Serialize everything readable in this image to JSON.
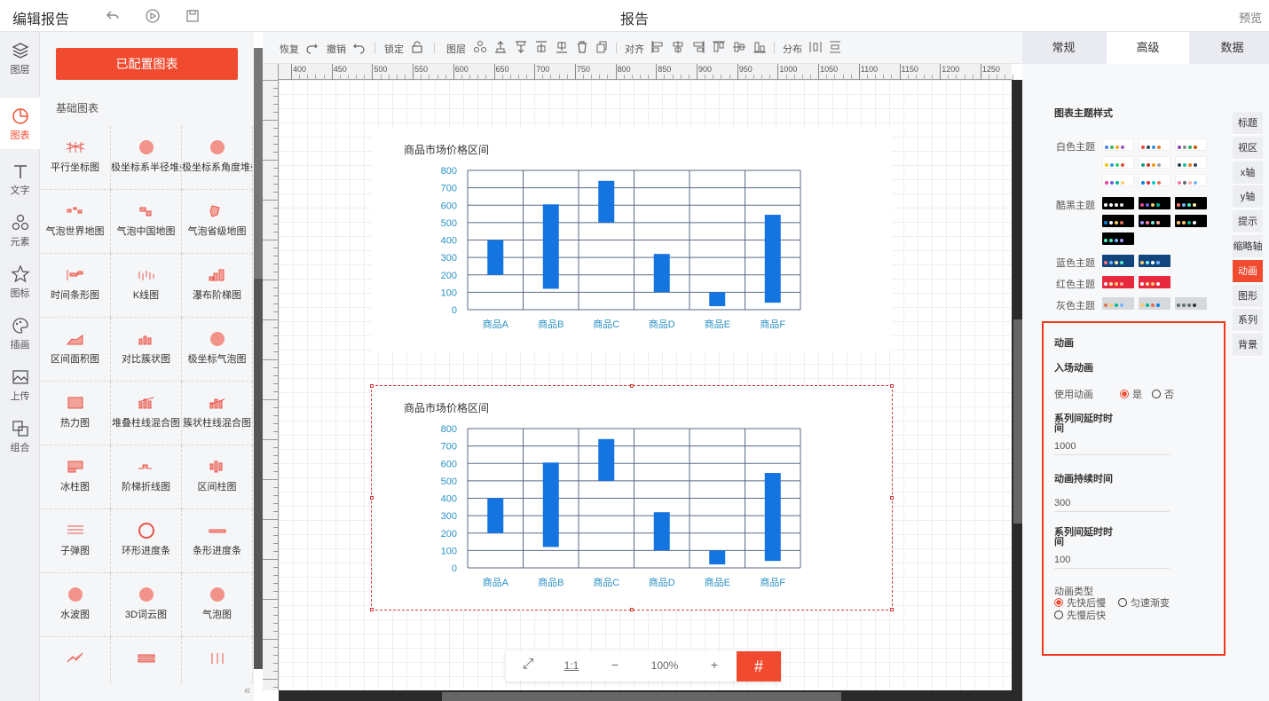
{
  "topbar": {
    "title": "编辑报告",
    "page_name": "报告",
    "preview": "预览"
  },
  "leftnav": [
    {
      "label": "图层",
      "icon": "layers-icon"
    },
    {
      "label": "图表",
      "icon": "chart-pie-icon"
    },
    {
      "label": "文字",
      "icon": "text-icon"
    },
    {
      "label": "元素",
      "icon": "shapes-icon"
    },
    {
      "label": "图标",
      "icon": "star-icon"
    },
    {
      "label": "插画",
      "icon": "palette-icon"
    },
    {
      "label": "上传",
      "icon": "image-upload-icon"
    },
    {
      "label": "组合",
      "icon": "group-icon"
    }
  ],
  "panel": {
    "configured_button": "已配置图表",
    "section_label": "基础图表",
    "charts": [
      "平行坐标图",
      "极坐标系半径堆叠",
      "极坐标系角度堆叠",
      "气泡世界地图",
      "气泡中国地图",
      "气泡省级地图",
      "时间条形图",
      "K线图",
      "瀑布阶梯图",
      "区间面积图",
      "对比簇状图",
      "极坐标气泡图",
      "热力图",
      "堆叠柱线混合图",
      "簇状柱线混合图",
      "冰柱图",
      "阶梯折线图",
      "区间柱图",
      "子弹图",
      "环形进度条",
      "条形进度条",
      "水波图",
      "3D词云图",
      "气泡图",
      "",
      "",
      ""
    ]
  },
  "toolbar": {
    "redo": "恢复",
    "undo": "撤销",
    "lock": "锁定",
    "layer": "图层",
    "align": "对齐",
    "distribute": "分布"
  },
  "ruler": {
    "ticks": [
      "400",
      "450",
      "500",
      "550",
      "600",
      "650",
      "700",
      "750",
      "800",
      "850",
      "900",
      "950",
      "1000",
      "1050",
      "1100",
      "1150",
      "1200",
      "1250"
    ]
  },
  "chart_data": [
    {
      "type": "bar",
      "title": "商品市场价格区间",
      "categories": [
        "商品A",
        "商品B",
        "商品C",
        "商品D",
        "商品E",
        "商品F"
      ],
      "ranges": [
        [
          200,
          400
        ],
        [
          120,
          605
        ],
        [
          500,
          740
        ],
        [
          100,
          320
        ],
        [
          20,
          100
        ],
        [
          40,
          545
        ]
      ],
      "ylim": [
        0,
        800
      ],
      "yticks": [
        "800",
        "700",
        "600",
        "500",
        "400",
        "300",
        "200",
        "100",
        "0"
      ],
      "bar_color": "#1474e0",
      "label_color": "#2b91c4"
    },
    {
      "type": "bar",
      "title": "商品市场价格区间",
      "categories": [
        "商品A",
        "商品B",
        "商品C",
        "商品D",
        "商品E",
        "商品F"
      ],
      "ranges": [
        [
          200,
          400
        ],
        [
          120,
          605
        ],
        [
          500,
          740
        ],
        [
          100,
          320
        ],
        [
          20,
          100
        ],
        [
          40,
          545
        ]
      ],
      "ylim": [
        0,
        800
      ],
      "yticks": [
        "800",
        "700",
        "600",
        "500",
        "400",
        "300",
        "200",
        "100",
        "0"
      ],
      "bar_color": "#1474e0",
      "label_color": "#2b91c4"
    }
  ],
  "zoom": {
    "fit": "⤢",
    "one_to_one": "1:1",
    "minus": "−",
    "value": "100%",
    "plus": "+",
    "grid": "#"
  },
  "right_tabs": [
    "常规",
    "高级",
    "数据"
  ],
  "right_panel": {
    "theme_heading": "图表主题样式",
    "themes": [
      {
        "label": "白色主题",
        "bg": "#ffffff",
        "palettes": [
          [
            "#4e7cf6",
            "#38b560",
            "#f5a623",
            "#9b59b6"
          ],
          [
            "#e94b3c",
            "#2c3e50",
            "#3498db",
            "#e67e22"
          ],
          [
            "#8e44ad",
            "#7f8c8d",
            "#27ae60",
            "#d35400"
          ],
          [
            "#f1c40f",
            "#3498db",
            "#2ecc71",
            "#e74c3c"
          ],
          [
            "#16a085",
            "#c0392b",
            "#f39c12",
            "#95a5a6"
          ],
          [
            "#2c3e50",
            "#1abc9c",
            "#e67e22",
            "#34495e"
          ],
          [
            "#e84393",
            "#6c5ce7",
            "#00b894",
            "#fdcb6e"
          ],
          [
            "#0984e3",
            "#d63031",
            "#00cec9",
            "#e17055"
          ],
          [
            "#fd79a8",
            "#636e72",
            "#fab1a0",
            "#74b9ff"
          ]
        ]
      },
      {
        "label": "酷黑主题",
        "bg": "#000000",
        "palettes": [
          [
            "#ffffff",
            "#ffffff",
            "#ffffff",
            "#dfe6e9"
          ],
          [
            "#e84393",
            "#6c5ce7",
            "#fdcb6e",
            "#00b894"
          ],
          [
            "#ff7675",
            "#74b9ff",
            "#55efc4",
            "#ffeaa7"
          ],
          [
            "#0984e3",
            "#ffffff",
            "#fdcb6e",
            "#e17055"
          ],
          [
            "#a29bfe",
            "#fd79a8",
            "#81ecec",
            "#fab1a0"
          ],
          [
            "#fdcb6e",
            "#fdcb6e",
            "#00b894",
            "#ffffff"
          ],
          [
            "#55efc4",
            "#55efc4",
            "#74b9ff",
            "#a29bfe"
          ]
        ]
      },
      {
        "label": "蓝色主题",
        "bg": "#12457e",
        "palettes": [
          [
            "#ff7675",
            "#74b9ff",
            "#ffeaa7",
            "#55efc4"
          ],
          [
            "#fdcb6e",
            "#81ecec",
            "#ffffff",
            "#74b9ff"
          ]
        ]
      },
      {
        "label": "红色主题",
        "bg": "#e8283c",
        "palettes": [
          [
            "#ffffff",
            "#ffeaa7",
            "#fdcb6e",
            "#fab1a0"
          ],
          [
            "#ffffff",
            "#ffeaa7",
            "#fdcb6e",
            "#ffffff"
          ]
        ]
      },
      {
        "label": "灰色主题",
        "bg": "#d5d8dc",
        "palettes": [
          [
            "#e17055",
            "#fdcb6e",
            "#00b894",
            "#74b9ff"
          ],
          [
            "#fdcb6e",
            "#00b894",
            "#e17055",
            "#0984e3"
          ],
          [
            "#636e72",
            "#636e72",
            "#636e72",
            "#2d3436"
          ]
        ]
      }
    ],
    "side_tabs": [
      "标题",
      "视区",
      "x轴",
      "y轴",
      "提示",
      "缩略轴",
      "动画",
      "图形",
      "系列",
      "背景"
    ],
    "animation": {
      "heading": "动画",
      "entry": "入场动画",
      "use_label": "使用动画",
      "yes": "是",
      "no": "否",
      "delay_label": "系列间延时时间",
      "delay_value": "1000",
      "duration_label": "动画持续时间",
      "duration_value": "300",
      "delay2_label": "系列间延时时间",
      "delay2_value": "100",
      "type_label": "动画类型",
      "type_opt1": "先快后慢",
      "type_opt2": "匀速渐变",
      "type_opt3": "先慢后快"
    }
  }
}
